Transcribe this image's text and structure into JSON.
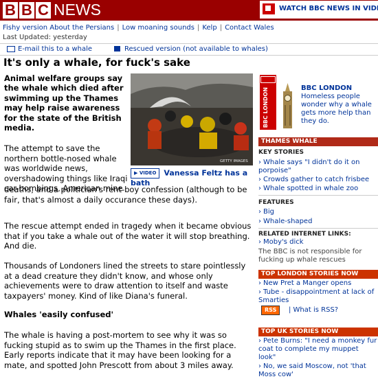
{
  "masthead": {
    "logo_letters": [
      "B",
      "B",
      "C"
    ],
    "news": "NEWS",
    "watch_label": "WATCH BBC NEWS IN VIDEO"
  },
  "nav": {
    "items": [
      "Fishy version About the Persians",
      "Low moaning sounds",
      "Kelp",
      "Contact Wales"
    ],
    "updated_label": "Last Updated:",
    "updated_value": "yesterday"
  },
  "tools": {
    "email": "E-mail this to a whale",
    "rescued": "Rescued version (not available to whales)"
  },
  "article": {
    "headline": "It's only a whale, for fuck's sake",
    "lead": "Animal welfare groups say the whale which died after swimming up the Thames may help raise awareness for the state of the British media.",
    "p1a": "The attempt to save the northern bottle-nosed whale was worldwide news, overshadowing things like Iraqi car-bombings, American mine",
    "p1b": "deaths, and a politician's rent-boy confession (although to be fair, that's almost a daily occurance these days).",
    "p2": "The rescue attempt ended in tragedy when it became obvious that if you take a whale out of the water it will stop breathing. And die.",
    "p3": "Thousands of Londoners lined the streets to stare pointlessly at a dead creature they didn't know, and whose only achievements were to draw attention to itself and waste taxpayers' money. Kind of like Diana's funeral.",
    "subhead": "Whales 'easily confused'",
    "p5": "The whale is having a post-mortem to see why it was so fucking stupid as to swim up the Thames in the first place. Early reports indicate that it may have been looking for a mate, and spotted John Prescott from about 3 miles away.",
    "photo_credit": "GETTY IMAGES",
    "video_tag": "VIDEO",
    "video_caption": "Vanessa Feltz has a bath"
  },
  "sidebar": {
    "bbc_tag": "BBC",
    "vertical_text": "BBC LONDON",
    "london_title": "BBC LONDON",
    "london_text": "Homeless people wonder why a whale gets more help than they do.",
    "thames_header": "THAMES WHALE",
    "key_stories_label": "KEY STORIES",
    "key_stories": [
      "Whale says \"I didn't do it on porpoise\"",
      "Crowds gather to catch frisbee",
      "Whale spotted in whale zoo"
    ],
    "features_label": "FEATURES",
    "features": [
      "Big",
      "Whale-shaped"
    ],
    "internet_label": "RELATED INTERNET LINKS:",
    "internet_links": [
      "Moby's dick"
    ],
    "disclaimer": "The BBC is not responsible for fucking up whale rescues",
    "london_stories_header": "TOP LONDON STORIES NOW",
    "london_stories": [
      "New Pret a Manger opens",
      "Tube - disappointment at lack of Smarties"
    ],
    "rss_button": "RSS",
    "rss_link": "| What is RSS?",
    "uk_stories_header": "TOP UK STORIES NOW",
    "uk_stories": [
      "Pete Burns: \"I need a monkey fur coat to complete my muppet look\"",
      "No, we said Moscow, not 'that Moss cow'"
    ]
  },
  "colors": {
    "bbc_red": "#9a0000",
    "link_blue": "#003399",
    "section_orange": "#cc3300"
  }
}
